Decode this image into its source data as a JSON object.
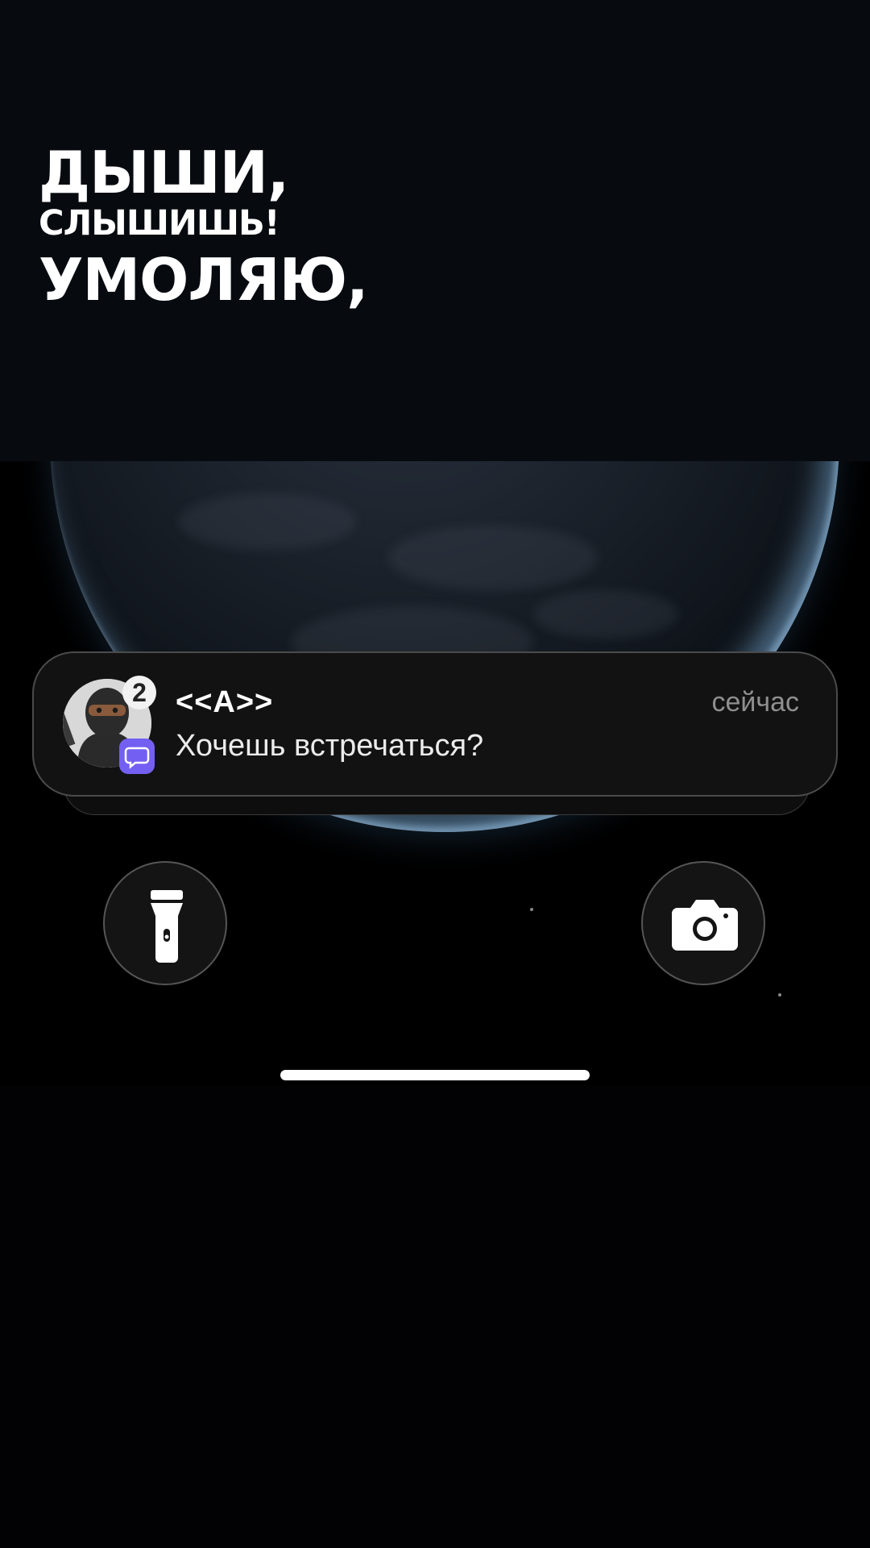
{
  "headline": {
    "line1": "ДЫШИ,",
    "line2": "СЛЫШИШЬ!",
    "line3": "УМОЛЯЮ,"
  },
  "notification": {
    "sender": "<<A>>",
    "time": "сейчас",
    "message": "Хочешь встречаться?",
    "badge_count": "2",
    "avatar_icon": "ninja-avatar-icon",
    "app_icon": "viber-app-icon",
    "app_color": "#7360f2"
  },
  "quick_actions": {
    "flashlight_icon": "flashlight-icon",
    "camera_icon": "camera-icon"
  },
  "colors": {
    "top_background": "#070b10",
    "lock_background": "#000000",
    "notification_background": "#121212",
    "time_text": "#8f8f8f"
  }
}
